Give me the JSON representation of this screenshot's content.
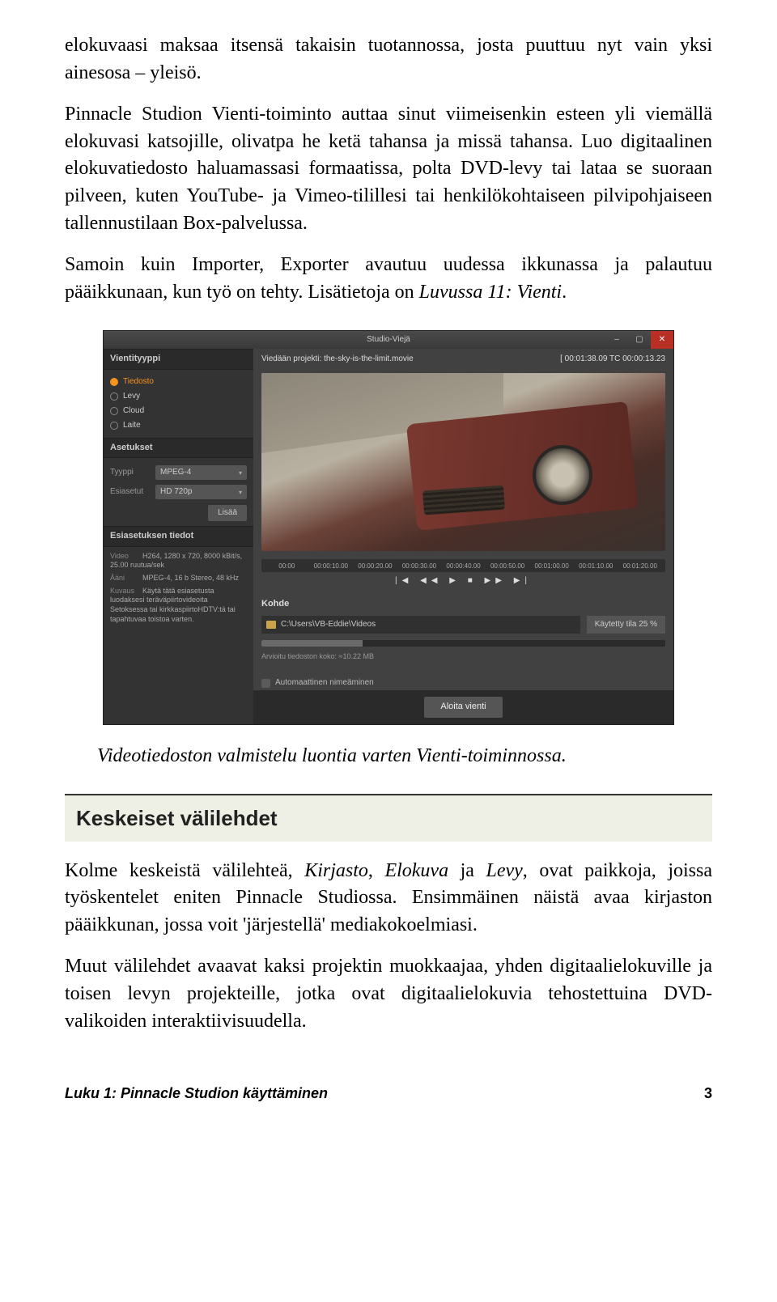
{
  "paragraphs": {
    "p1": "elokuvaasi maksaa itsensä takaisin tuotannossa, josta puuttuu nyt vain yksi ainesosa – yleisö.",
    "p2a": "Pinnacle Studion Vienti-toiminto auttaa sinut viimeisenkin esteen yli viemällä elokuvasi katsojille, olivatpa he ketä tahansa ja missä tahansa. Luo digitaalinen elokuvatiedosto haluamassasi formaatissa, polta DVD-levy tai lataa se suoraan pilveen, kuten YouTube- ja Vimeo-tilillesi tai henkilökohtaiseen pilvipohjaiseen tallennustilaan Box-palvelussa.",
    "p3a": "Samoin kuin Importer, Exporter avautuu uudessa ikkunassa ja palautuu pääikkunaan, kun työ on tehty. Lisätietoja on ",
    "p3b": "Luvussa 11: Vienti",
    "p3c": ".",
    "caption": "Videotiedoston valmistelu luontia varten Vienti-toiminnossa.",
    "section": "Keskeiset välilehdet",
    "p4a": "Kolme keskeistä välilehteä, ",
    "p4b": "Kirjasto",
    "p4c": ", ",
    "p4d": "Elokuva",
    "p4e": " ja ",
    "p4f": "Levy",
    "p4g": ", ovat paikkoja, joissa työskentelet eniten Pinnacle Studiossa. Ensimmäinen näistä avaa kirjaston pääikkunan, jossa voit 'järjestellä' mediakokoelmiasi.",
    "p5": "Muut välilehdet avaavat kaksi projektin muokkaajaa, yhden digitaalielokuville ja toisen levyn projekteille, jotka ovat digitaalielokuvia tehostettuina DVD-valikoiden interaktiivisuudella."
  },
  "footer": {
    "left": "Luku 1: Pinnacle Studion käyttäminen",
    "right": "3"
  },
  "app": {
    "title": "Studio-Viejä",
    "win_min": "–",
    "win_max": "▢",
    "win_close": "✕",
    "project_label": "Viedään projekti: the-sky-is-the-limit.movie",
    "timecode": "[ 00:01:38.09   TC 00:00:13.23",
    "panels": {
      "vientityyppi": {
        "hdr": "Vientityyppi",
        "items": [
          "Tiedosto",
          "Levy",
          "Cloud",
          "Laite"
        ]
      },
      "asetukset": {
        "hdr": "Asetukset",
        "type_k": "Tyyppi",
        "type_v": "MPEG-4",
        "preset_k": "Esiasetut",
        "preset_v": "HD 720p",
        "lisaa": "Lisää"
      },
      "esiasetuksen": {
        "hdr": "Esiasetuksen tiedot",
        "video_k": "Video",
        "video_v": "H264, 1280 x 720, 8000 kBit/s, 25.00 ruutua/sek",
        "aani_k": "Ääni",
        "aani_v": "MPEG-4, 16 b Stereo, 48 kHz",
        "kuvaus_k": "Kuvaus",
        "kuvaus_v": "Käytä tätä esiasetusta luodaksesi teräväpiirtovideoita Setoksessa tai kirkkaspiirtoHDTV:tä tai tapahtuvaa toistoa varten."
      }
    },
    "timeline_ticks": [
      "00:00",
      "00:00:10.00",
      "00:00:20.00",
      "00:00:30.00",
      "00:00:40.00",
      "00:00:50.00",
      "00:01:00.00",
      "00:01:10.00",
      "00:01:20.00"
    ],
    "transport": "|◀ ◀◀ ▶ ■ ▶▶ ▶|",
    "kohde": {
      "hdr": "Kohde",
      "path": "C:\\Users\\VB-Eddie\\Videos",
      "progress_label": "Käytetty tila 25 %",
      "size_line": "Arvioitu tiedoston koko: ≈10.22 MB"
    },
    "auto_label": "Automaattinen nimeäminen",
    "start": "Aloita vienti"
  }
}
